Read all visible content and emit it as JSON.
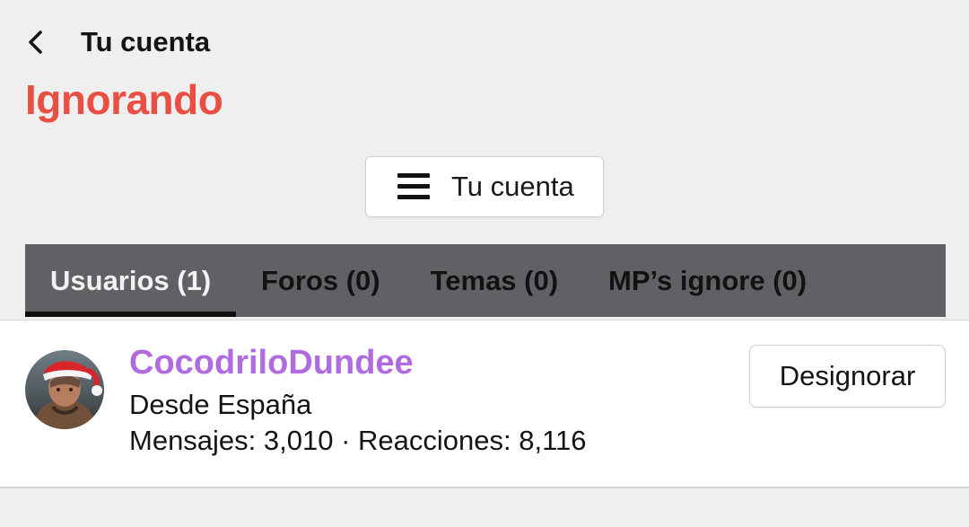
{
  "header": {
    "back_label": "Tu cuenta",
    "title": "Ignorando"
  },
  "account_menu": {
    "label": "Tu cuenta",
    "icon": "menu-icon"
  },
  "tabs": [
    {
      "label": "Usuarios (1)",
      "active": true
    },
    {
      "label": "Foros (0)",
      "active": false
    },
    {
      "label": "Temas (0)",
      "active": false
    },
    {
      "label": "MP’s ignore (0)",
      "active": false
    }
  ],
  "ignored_user": {
    "username": "CocodriloDundee",
    "location": "Desde España",
    "stats": "Mensajes: 3,010 · Reacciones: 8,116",
    "action_label": "Designorar"
  },
  "colors": {
    "title": "#ea4f43",
    "username": "#b16be0",
    "tabs_background": "#5f6164",
    "page_background": "#efefef"
  }
}
